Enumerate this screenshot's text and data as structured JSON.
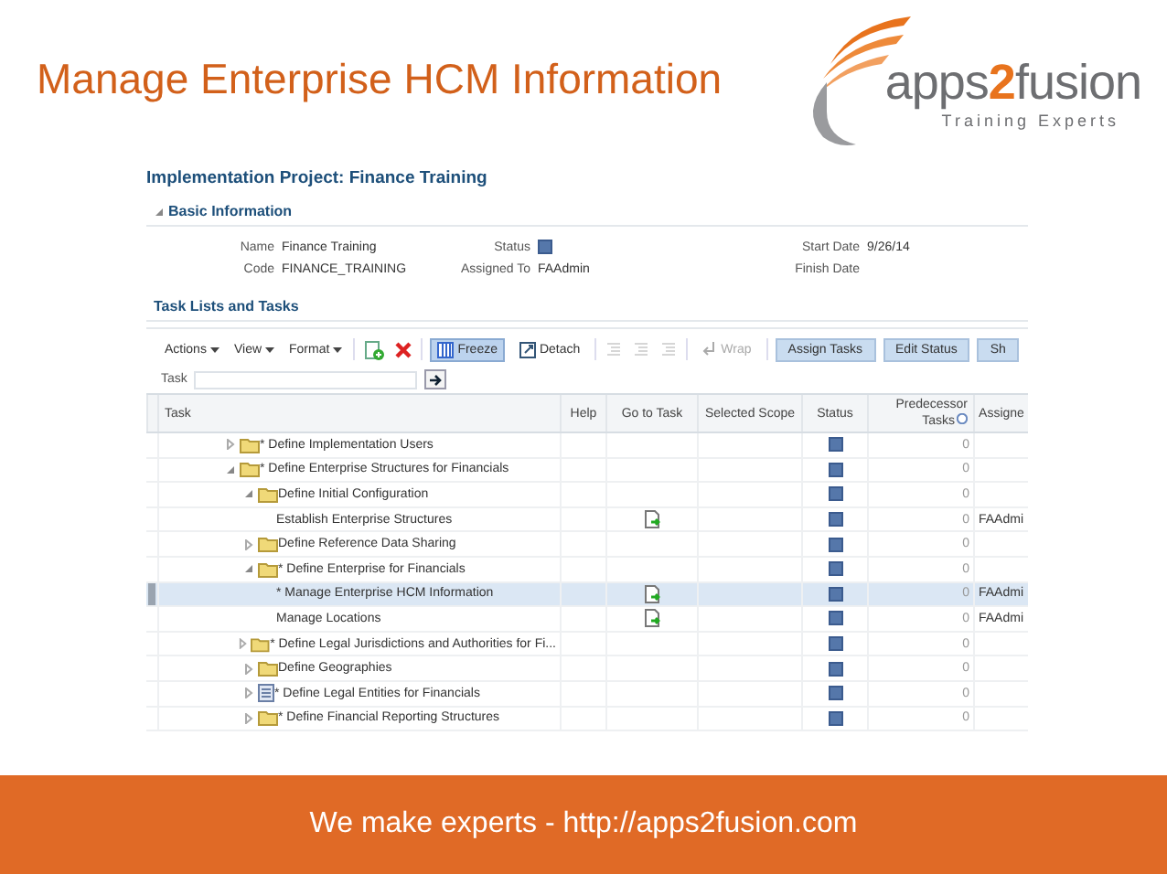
{
  "slide": {
    "title": "Manage Enterprise HCM Information",
    "logo": {
      "name_left": "apps",
      "name_digit": "2",
      "name_right": "fusion",
      "tagline": "Training Experts"
    },
    "footer": "We make experts - http://apps2fusion.com"
  },
  "page": {
    "title": "Implementation Project: Finance Training",
    "basic_section": {
      "title": "Basic Information",
      "expanded": true
    },
    "fields": [
      {
        "label": "Name",
        "value": "Finance Training",
        "kind": "text"
      },
      {
        "label": "Status",
        "kind": "status"
      },
      {
        "label": "Start Date",
        "value": "9/26/14",
        "kind": "text"
      },
      {
        "label": "Code",
        "value": "FINANCE_TRAINING",
        "kind": "text"
      },
      {
        "label": "Assigned To",
        "value": "FAAdmin",
        "kind": "text"
      },
      {
        "label": "Finish Date",
        "kind": "text"
      }
    ],
    "tasks_section": {
      "title": "Task Lists and Tasks"
    },
    "toolbar": [
      {
        "kind": "menu",
        "label": "Actions"
      },
      {
        "kind": "menu",
        "label": "View"
      },
      {
        "kind": "menu",
        "label": "Format"
      },
      {
        "kind": "icon",
        "disabled": false
      },
      {
        "kind": "icon",
        "disabled": false
      },
      {
        "kind": "toggle",
        "label": "Freeze",
        "selected": true
      },
      {
        "kind": "toggle",
        "label": "Detach",
        "selected": false
      },
      {
        "kind": "icon",
        "disabled": true
      },
      {
        "kind": "icon",
        "disabled": true
      },
      {
        "kind": "icon",
        "disabled": true
      },
      {
        "kind": "toggle",
        "label": "Wrap",
        "selected": false,
        "disabled": true
      },
      {
        "kind": "button",
        "label": "Assign Tasks"
      },
      {
        "kind": "button",
        "label": "Edit Status"
      },
      {
        "kind": "button",
        "label": "Sh"
      }
    ],
    "filter": {
      "label": "Task"
    },
    "columns": [
      "Task",
      "Help",
      "Go to Task",
      "Selected Scope",
      "Status",
      "Predecessor Tasks",
      "Assigne"
    ],
    "tree": [
      {
        "label": "* Define Implementation Users",
        "kind": "folder",
        "expanded": false,
        "predecessors": "0",
        "selected": false
      },
      {
        "label": "* Define Enterprise Structures for Financials",
        "kind": "folder",
        "expanded": true,
        "predecessors": "0",
        "selected": false,
        "children": [
          {
            "label": "Define Initial Configuration",
            "kind": "folder",
            "expanded": true,
            "predecessors": "0",
            "selected": false,
            "children": [
              {
                "label": "Establish Enterprise Structures",
                "kind": "task",
                "predecessors": "0",
                "assigned": "FAAdmi",
                "selected": false
              }
            ]
          },
          {
            "label": "Define Reference Data Sharing",
            "kind": "folder",
            "expanded": false,
            "predecessors": "0",
            "selected": false
          },
          {
            "label": "* Define Enterprise for Financials",
            "kind": "folder",
            "expanded": true,
            "predecessors": "0",
            "selected": false,
            "children": [
              {
                "label": "* Manage Enterprise HCM Information",
                "kind": "task",
                "predecessors": "0",
                "assigned": "FAAdmi",
                "selected": true
              },
              {
                "label": "Manage Locations",
                "kind": "task",
                "predecessors": "0",
                "assigned": "FAAdmi",
                "selected": false
              }
            ]
          },
          {
            "label": "* Define Legal Jurisdictions and Authorities for Fi...",
            "kind": "folder",
            "expanded": false,
            "predecessors": "0",
            "selected": false
          },
          {
            "label": "Define Geographies",
            "kind": "folder",
            "expanded": false,
            "predecessors": "0",
            "selected": false
          },
          {
            "label": "* Define Legal Entities for Financials",
            "kind": "list",
            "expanded": false,
            "predecessors": "0",
            "selected": false
          },
          {
            "label": "* Define Financial Reporting Structures",
            "kind": "folder",
            "expanded": false,
            "predecessors": "0",
            "selected": false
          }
        ]
      }
    ]
  }
}
